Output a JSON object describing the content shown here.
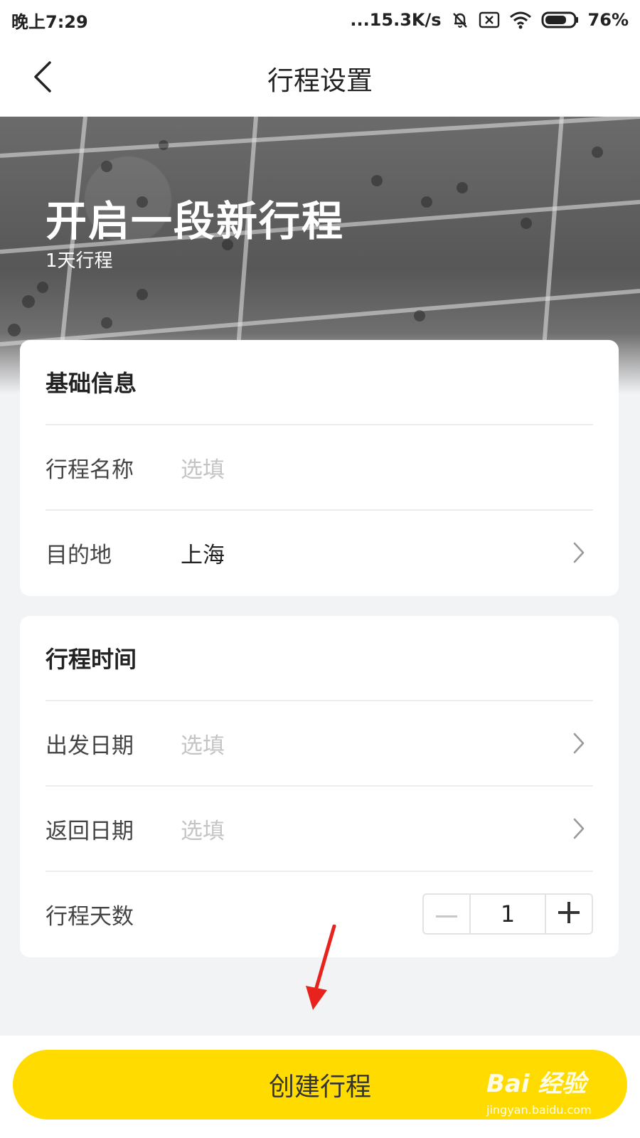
{
  "status_bar": {
    "time": "晚上7:29",
    "network_speed": "...15.3K/s",
    "battery": "76%",
    "battery_level": 0.76,
    "icons": [
      "mute-icon",
      "sim-blocked-icon",
      "wifi-icon",
      "battery-icon"
    ]
  },
  "nav": {
    "title": "行程设置",
    "back_icon": "chevron-left-icon"
  },
  "hero": {
    "title": "开启一段新行程",
    "subtitle": "1天行程"
  },
  "basic_info": {
    "heading": "基础信息",
    "rows": [
      {
        "label": "行程名称",
        "placeholder": "选填",
        "value": ""
      },
      {
        "label": "目的地",
        "value": "上海",
        "icon": "chevron-right-icon"
      }
    ]
  },
  "trip_time": {
    "heading": "行程时间",
    "rows": [
      {
        "label": "出发日期",
        "placeholder": "选填",
        "icon": "chevron-right-icon"
      },
      {
        "label": "返回日期",
        "placeholder": "选填",
        "icon": "chevron-right-icon"
      },
      {
        "label": "行程天数",
        "stepper_value": "1"
      }
    ]
  },
  "stepper": {
    "minus_icon": "minus-icon",
    "plus_icon": "plus-icon"
  },
  "bottom": {
    "create_button": "创建行程"
  },
  "watermark": {
    "logo": "Bai 经验",
    "url": "jingyan.baidu.com"
  },
  "colors": {
    "accent": "#ffdb00",
    "annotation": "#e8231e",
    "page_bg": "#f2f3f5"
  }
}
